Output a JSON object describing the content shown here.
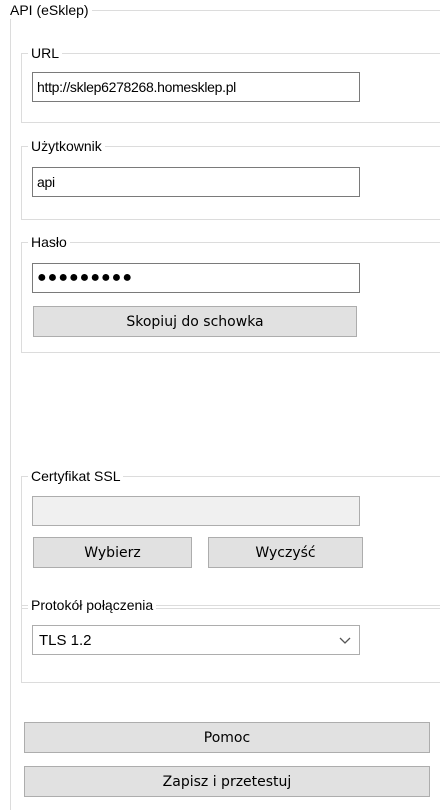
{
  "api_group": {
    "title": "API (eSklep)"
  },
  "url_group": {
    "title": "URL",
    "value": "http://sklep6278268.homesklep.pl"
  },
  "user_group": {
    "title": "Użytkownik",
    "value": "api"
  },
  "password_group": {
    "title": "Hasło",
    "masked_value": "●●●●●●●●●",
    "copy_button": "Skopiuj do schowka"
  },
  "ssl_group": {
    "title": "Certyfikat SSL",
    "value": "",
    "choose_button": "Wybierz",
    "clear_button": "Wyczyść"
  },
  "protocol_group": {
    "title": "Protokół połączenia",
    "selected": "TLS 1.2",
    "icon": "chevron-down-icon"
  },
  "actions": {
    "help_button": "Pomoc",
    "save_test_button": "Zapisz i przetestuj"
  }
}
